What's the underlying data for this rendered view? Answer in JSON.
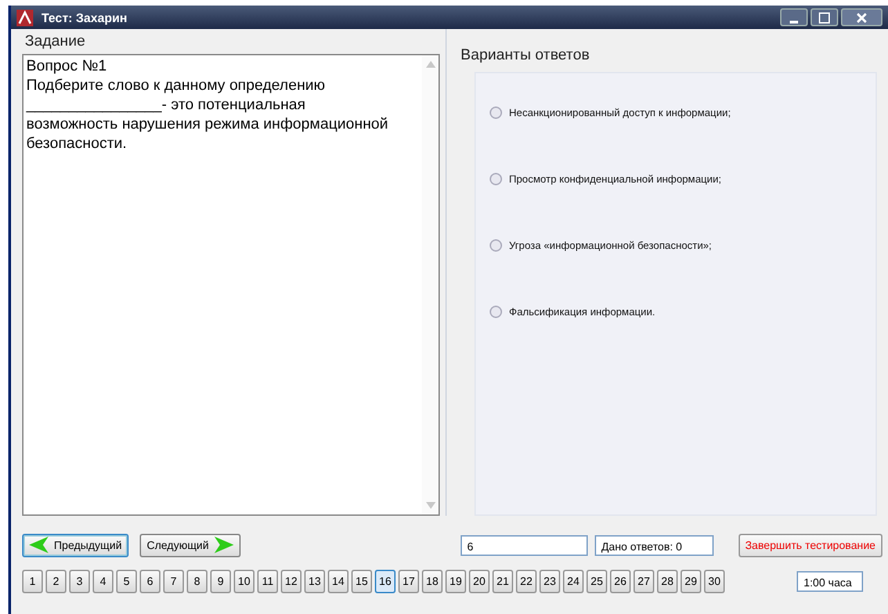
{
  "window": {
    "title": "Тест: Захарин"
  },
  "task": {
    "heading": "Задание",
    "lines": [
      "Вопрос №1",
      "Подберите слово к данному определению",
      "________________- это потенциальная",
      "возможность нарушения режима информационной",
      "безопасности."
    ]
  },
  "answers": {
    "heading": "Варианты ответов",
    "options": [
      {
        "label": "Несанкционированный доступ к информации;",
        "selected": false
      },
      {
        "label": "Просмотр конфиденциальной информации;",
        "selected": false
      },
      {
        "label": "Угроза «информационной безопасности»;",
        "selected": false
      },
      {
        "label": "Фальсификация информации.",
        "selected": false
      }
    ]
  },
  "nav": {
    "previous": "Предыдущий",
    "next": "Следующий",
    "answer_field": "6",
    "answered": "Дано ответов: 0",
    "finish": "Завершить тестирование"
  },
  "questions": [
    {
      "label": "1",
      "selected": false
    },
    {
      "label": "2",
      "selected": false
    },
    {
      "label": "3",
      "selected": false
    },
    {
      "label": "4",
      "selected": false
    },
    {
      "label": "5",
      "selected": false
    },
    {
      "label": "6",
      "selected": false
    },
    {
      "label": "7",
      "selected": false
    },
    {
      "label": "8",
      "selected": false
    },
    {
      "label": "9",
      "selected": false
    },
    {
      "label": "10",
      "selected": false
    },
    {
      "label": "11",
      "selected": false
    },
    {
      "label": "12",
      "selected": false
    },
    {
      "label": "13",
      "selected": false
    },
    {
      "label": "14",
      "selected": false
    },
    {
      "label": "15",
      "selected": false
    },
    {
      "label": "16",
      "selected": true
    },
    {
      "label": "17",
      "selected": false
    },
    {
      "label": "18",
      "selected": false
    },
    {
      "label": "19",
      "selected": false
    },
    {
      "label": "20",
      "selected": false
    },
    {
      "label": "21",
      "selected": false
    },
    {
      "label": "22",
      "selected": false
    },
    {
      "label": "23",
      "selected": false
    },
    {
      "label": "24",
      "selected": false
    },
    {
      "label": "25",
      "selected": false
    },
    {
      "label": "26",
      "selected": false
    },
    {
      "label": "27",
      "selected": false
    },
    {
      "label": "28",
      "selected": false
    },
    {
      "label": "29",
      "selected": false
    },
    {
      "label": "30",
      "selected": false
    }
  ],
  "timer": "1:00 часа"
}
